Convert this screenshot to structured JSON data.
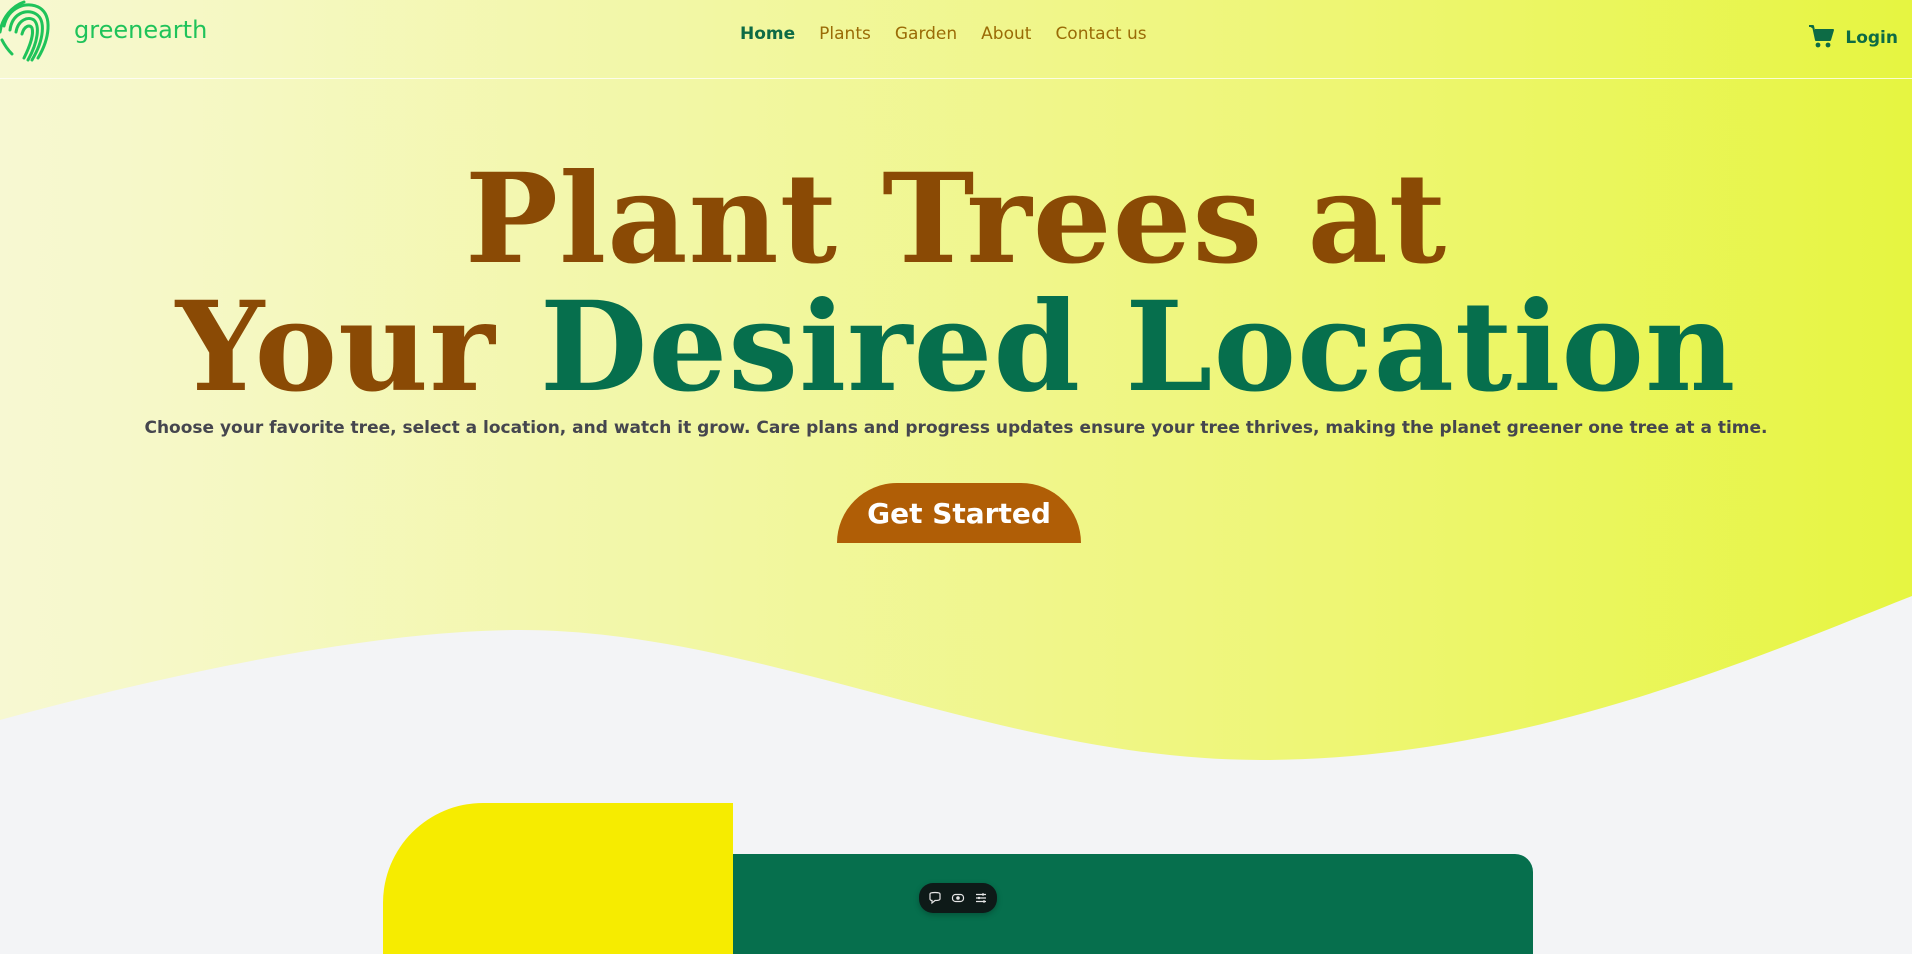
{
  "brand": {
    "name": "greenearth"
  },
  "nav": {
    "items": [
      {
        "label": "Home",
        "active": true
      },
      {
        "label": "Plants",
        "active": false
      },
      {
        "label": "Garden",
        "active": false
      },
      {
        "label": "About",
        "active": false
      },
      {
        "label": "Contact us",
        "active": false
      }
    ]
  },
  "header": {
    "cart_icon": "cart-icon",
    "login_label": "Login"
  },
  "hero": {
    "title_line1": "Plant Trees at",
    "title_line2_brown": "Your",
    "title_line2_green": "Desired Location",
    "subtitle": "Choose your favorite tree, select a location, and watch it grow. Care plans and progress updates ensure your tree thrives, making the planet greener one tree at a time.",
    "cta_label": "Get Started"
  },
  "floating_toolbar": {
    "icons": [
      "comment-icon",
      "eye-icon",
      "settings-list-icon"
    ]
  },
  "colors": {
    "brown": "#8a4a05",
    "green": "#066f4d",
    "cta": "#b05e06",
    "nav_link": "#9a6b06",
    "logo_green": "#1fc35a",
    "card_yellow": "#f6ec00"
  }
}
